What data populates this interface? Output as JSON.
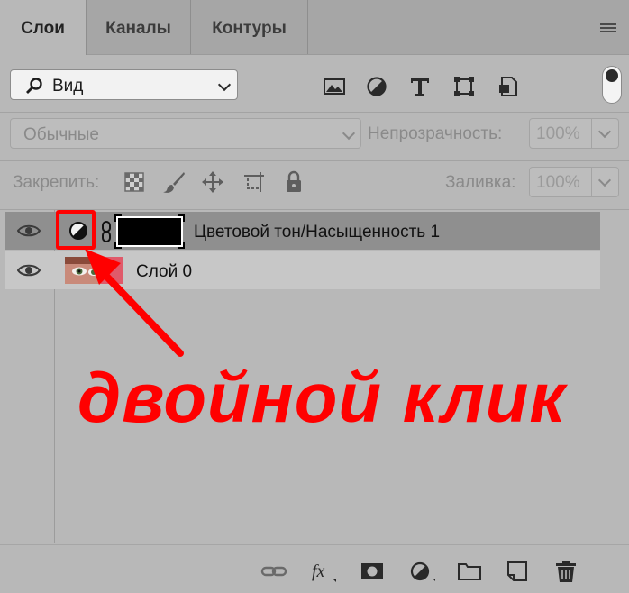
{
  "tabs": [
    {
      "label": "Слои",
      "active": true
    },
    {
      "label": "Каналы",
      "active": false
    },
    {
      "label": "Контуры",
      "active": false
    }
  ],
  "filter": {
    "kind_label": "Вид",
    "icons": [
      "image-filter-icon",
      "adjustment-filter-icon",
      "type-filter-icon",
      "shape-filter-icon",
      "smart-object-filter-icon"
    ]
  },
  "blend": {
    "mode": "Обычные",
    "opacity_label": "Непрозрачность:",
    "opacity_value": "100%"
  },
  "lock": {
    "label": "Закрепить:",
    "fill_label": "Заливка:",
    "fill_value": "100%"
  },
  "layers": [
    {
      "name": "Цветовой тон/Насыщенность 1",
      "type": "adjustment",
      "selected": true,
      "visible": true
    },
    {
      "name": "Слой 0",
      "type": "image",
      "selected": false,
      "visible": true
    }
  ],
  "annotation": {
    "text": "двойной клик",
    "color": "#ff0000"
  },
  "colors": {
    "panel": "#b8b8b8",
    "selected_row": "#8f8f8f",
    "annotation": "#ff0000"
  },
  "bottom_icons": [
    "link-layers-icon",
    "fx-icon",
    "mask-icon",
    "adjustment-layer-icon",
    "group-folder-icon",
    "new-layer-icon",
    "trash-icon"
  ]
}
